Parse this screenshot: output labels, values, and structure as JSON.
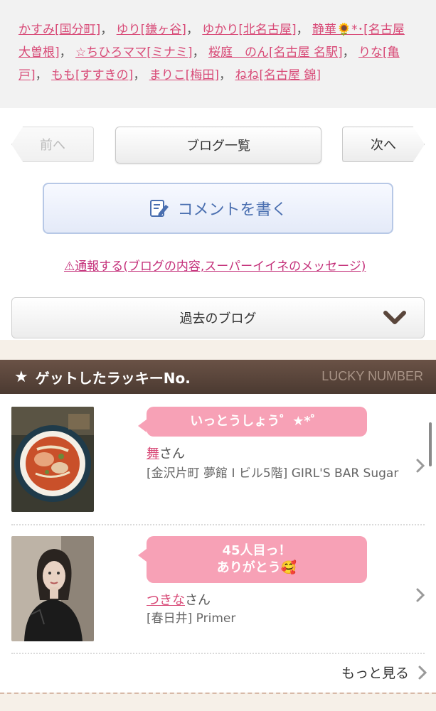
{
  "link_cloud": {
    "links": [
      "かすみ[国分町]",
      "ゆり[鎌ヶ谷]",
      "ゆかり[北名古屋]",
      "静華🌻*･[名古屋 大曽根]",
      "☆ちひろママ[ミナミ]",
      "桜庭　のん[名古屋 名駅]",
      "りな[亀戸]",
      "もも[すすきの]",
      "まりこ[梅田]",
      "ねね[名古屋 錦]"
    ],
    "separator": "，"
  },
  "nav": {
    "prev_label": "前へ",
    "list_label": "ブログ一覧",
    "next_label": "次へ"
  },
  "comment": {
    "label": "コメントを書く",
    "icon": "pencil-note-icon"
  },
  "report_link": "⚠通報する(ブログの内容,スーパーイイネのメッセージ)",
  "past_blog": {
    "label": "過去のブログ",
    "icon": "chevron-down-icon"
  },
  "lucky": {
    "star": "★",
    "title": "ゲットしたラッキーNo.",
    "title_en": "LUCKY NUMBER",
    "items": [
      {
        "bubble": "いっとうしょう゜★*゜",
        "name": "舞",
        "suffix": "さん",
        "shop": "[金沢片町 夢館 I ビル5階] GIRL'S BAR Sugar",
        "thumb": "ramen-photo"
      },
      {
        "bubble_line1": "45人目っ！",
        "bubble_line2": "ありがとう🥰",
        "name": "つきな",
        "suffix": "さん",
        "shop": "[春日井] Primer",
        "thumb": "portrait-photo"
      }
    ],
    "more_label": "もっと見る"
  },
  "colors": {
    "link": "#d84a77",
    "bubble": "#f7a1b6",
    "lucky_bar": "#5a463b",
    "comment_text": "#4a6fb0"
  }
}
